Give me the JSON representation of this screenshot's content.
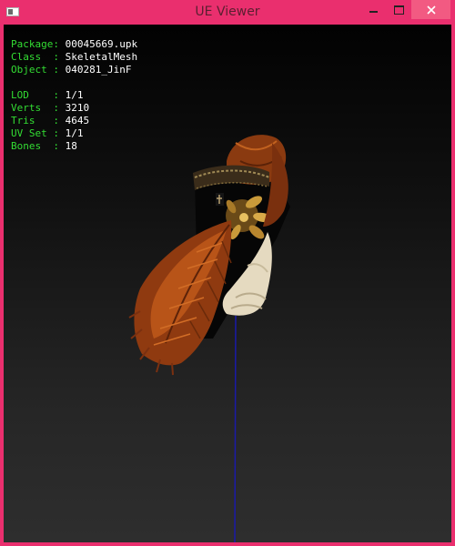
{
  "window": {
    "title": "UE Viewer",
    "accent_color": "#ea2f6e",
    "controls": [
      "minimize-icon",
      "maximize-icon",
      "close-icon"
    ]
  },
  "info": {
    "package": {
      "label": "Package:",
      "value": "00045669.upk"
    },
    "class": {
      "label": "Class  :",
      "value": "SkeletalMesh"
    },
    "object": {
      "label": "Object :",
      "value": "040281_JinF"
    },
    "lod": {
      "label": "LOD    :",
      "value": "1/1"
    },
    "verts": {
      "label": "Verts  :",
      "value": "3210"
    },
    "tris": {
      "label": "Tris   :",
      "value": "4645"
    },
    "uvset": {
      "label": "UV Set :",
      "value": "1/1"
    },
    "bones": {
      "label": "Bones  :",
      "value": "18"
    }
  },
  "colors": {
    "label": "#33dd33",
    "value": "#ffffff",
    "axis": "#1a1aa8"
  }
}
